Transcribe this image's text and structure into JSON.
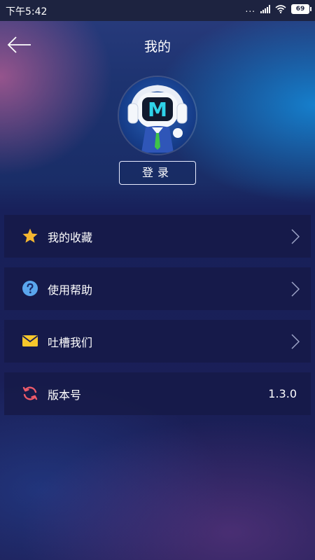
{
  "status_bar": {
    "time": "下午5:42",
    "dots": "...",
    "battery": "69"
  },
  "header": {
    "title": "我的",
    "login_label": "登录",
    "avatar_letter": "M"
  },
  "menu": {
    "items": [
      {
        "label": "我的收藏",
        "icon": "star-icon",
        "icon_color": "#f5b731"
      },
      {
        "label": "使用帮助",
        "icon": "help-icon",
        "icon_color": "#5aa6ee"
      },
      {
        "label": "吐槽我们",
        "icon": "mail-icon",
        "icon_color": "#f7c72b"
      },
      {
        "label": "版本号",
        "icon": "refresh-icon",
        "icon_color": "#ef5b6a",
        "value": "1.3.0"
      }
    ]
  },
  "colors": {
    "accent_blue": "#1a8fdc",
    "panel": "#161a48",
    "background": "#1a1f57"
  }
}
